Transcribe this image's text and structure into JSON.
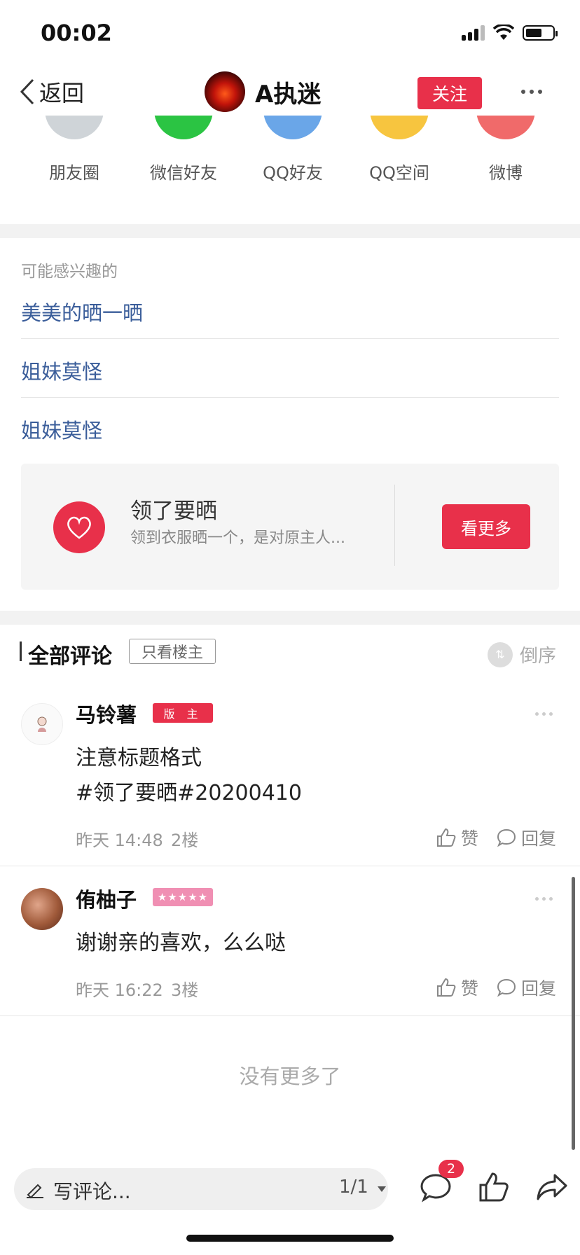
{
  "status_bar": {
    "time": "00:02"
  },
  "nav": {
    "back_label": "返回",
    "user_name": "A执迷",
    "follow_label": "关注"
  },
  "share": {
    "items": [
      {
        "label": "朋友圈",
        "color": "#cfd4d8"
      },
      {
        "label": "微信好友",
        "color": "#2bc443"
      },
      {
        "label": "QQ好友",
        "color": "#6aa6e8"
      },
      {
        "label": "QQ空间",
        "color": "#f7c53f"
      },
      {
        "label": "微博",
        "color": "#f06a6a"
      }
    ]
  },
  "interest": {
    "title": "可能感兴趣的",
    "items": [
      "美美的晒一晒",
      "姐妹莫怪",
      "姐妹莫怪"
    ]
  },
  "card": {
    "title": "领了要晒",
    "desc": "领到衣服晒一个，是对原主人...",
    "button": "看更多"
  },
  "comments_header": {
    "title": "全部评论",
    "only_host": "只看楼主",
    "order": "倒序"
  },
  "comments": [
    {
      "name": "马铃薯",
      "badge": "版 主",
      "text_lines": [
        "注意标题格式",
        "#领了要晒#20200410"
      ],
      "time": "昨天 14:48",
      "floor": "2楼",
      "like": "赞",
      "reply": "回复"
    },
    {
      "name": "侑柚子",
      "badge": "★★★★★",
      "text_lines": [
        "谢谢亲的喜欢，么么哒"
      ],
      "time": "昨天 16:22",
      "floor": "3楼",
      "like": "赞",
      "reply": "回复"
    }
  ],
  "no_more": "没有更多了",
  "bottom_bar": {
    "placeholder": "写评论...",
    "page_indicator": "1/1",
    "comment_count": "2"
  },
  "colors": {
    "accent": "#e8304a",
    "link": "#3a5d9a"
  }
}
